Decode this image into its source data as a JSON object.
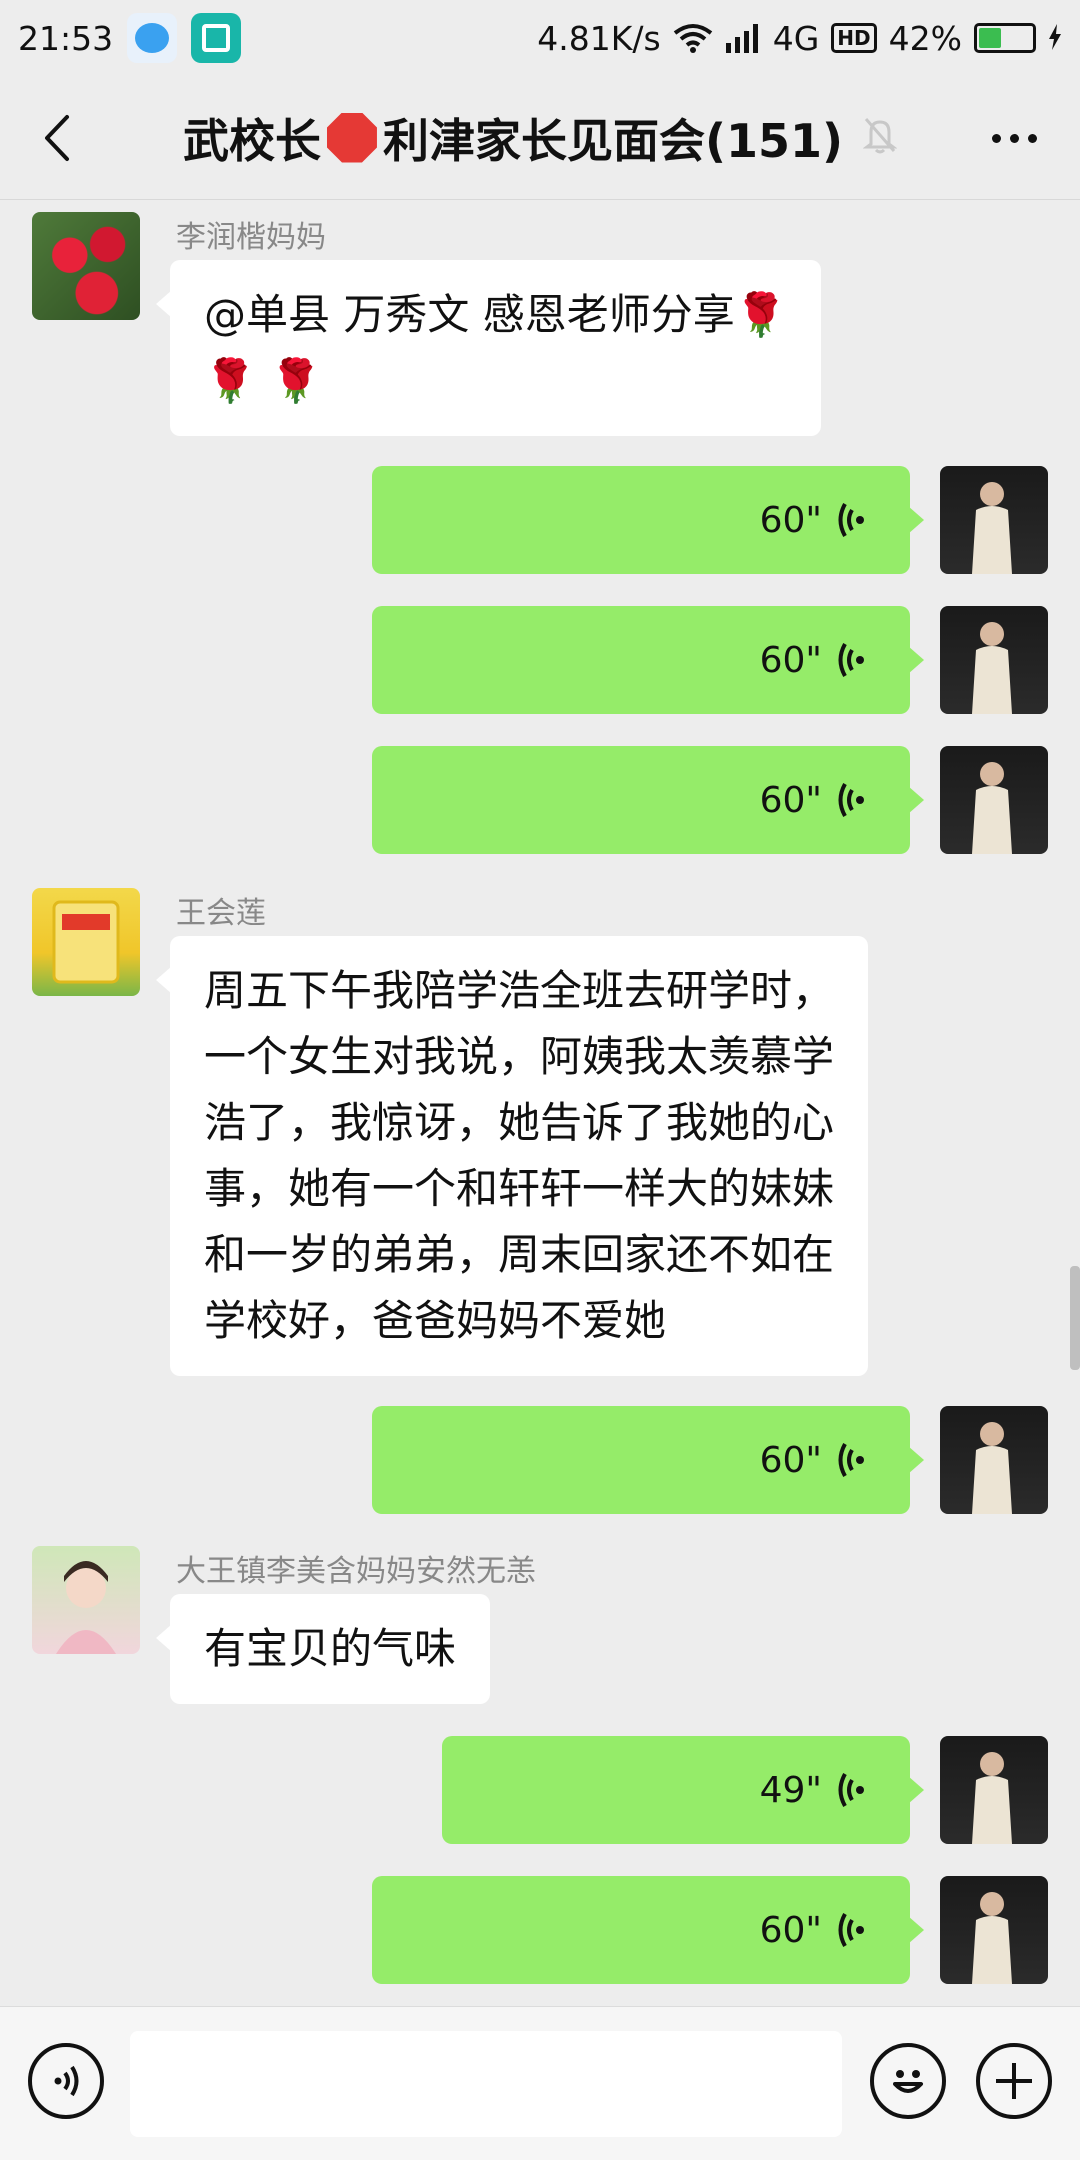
{
  "status_bar": {
    "time": "21:53",
    "network_speed": "4.81K/s",
    "network_type": "4G",
    "hd_label": "HD",
    "battery_percent": "42%",
    "battery_level": 0.42
  },
  "nav": {
    "title_prefix": "武校长",
    "title_suffix": "利津家长见面会(151)"
  },
  "messages": [
    {
      "type": "text",
      "side": "left",
      "sender": "李润楷妈妈",
      "line1": "@单县  万秀文  感恩老师分享🌹",
      "line2": "🌹 🌹"
    },
    {
      "type": "voice",
      "side": "right",
      "duration": "60\""
    },
    {
      "type": "voice",
      "side": "right",
      "duration": "60\""
    },
    {
      "type": "voice",
      "side": "right",
      "duration": "60\""
    },
    {
      "type": "text",
      "side": "left",
      "sender": "王会莲",
      "lines": [
        "周五下午我陪学浩全班去研学时，",
        "一个女生对我说，阿姨我太羡慕学",
        "浩了，我惊讶，她告诉了我她的心",
        "事，她有一个和轩轩一样大的妹妹",
        "和一岁的弟弟，周末回家还不如在",
        "学校好，爸爸妈妈不爱她"
      ]
    },
    {
      "type": "voice",
      "side": "right",
      "duration": "60\""
    },
    {
      "type": "text",
      "side": "left",
      "sender": "大王镇李美含妈妈安然无恙",
      "line1": "有宝贝的气味"
    },
    {
      "type": "voice",
      "side": "right",
      "duration": "49\""
    },
    {
      "type": "voice",
      "side": "right",
      "duration": "60\""
    }
  ],
  "input": {
    "value": ""
  },
  "colors": {
    "background": "#ededed",
    "outgoing_bubble": "#95ec69",
    "incoming_bubble": "#ffffff",
    "name_text": "#888888"
  }
}
